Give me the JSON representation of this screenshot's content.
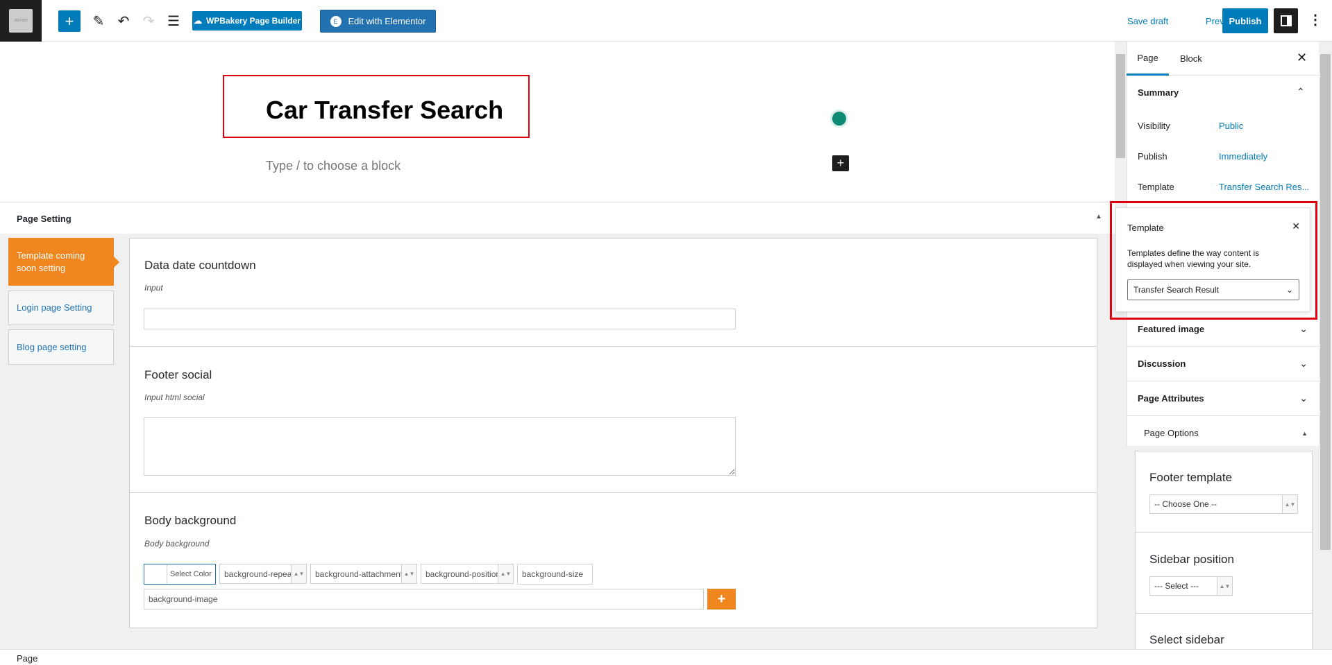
{
  "topbar": {
    "logo_text": "300×300",
    "wpbakery_label": "WPBakery Page Builder",
    "elementor_label": "Edit with Elementor",
    "save_draft": "Save draft",
    "preview": "Preview",
    "publish": "Publish"
  },
  "editor": {
    "title": "Car Transfer Search",
    "block_placeholder": "Type / to choose a block"
  },
  "page_setting": {
    "header": "Page Setting",
    "tabs": [
      {
        "label": "Template coming soon setting",
        "active": true
      },
      {
        "label": "Login page Setting"
      },
      {
        "label": "Blog page setting"
      }
    ],
    "sections": [
      {
        "title": "Data date countdown",
        "label": "Input",
        "value": ""
      },
      {
        "title": "Footer social",
        "label": "Input html social",
        "value": ""
      },
      {
        "title": "Body background",
        "label": "Body background",
        "controls": {
          "color": "Select Color",
          "repeat": "background-repeat",
          "attachment": "background-attachment",
          "position": "background-position",
          "size": "background-size",
          "image": "background-image"
        }
      }
    ]
  },
  "sidebar": {
    "tabs": [
      "Page",
      "Block"
    ],
    "active_tab": "Page",
    "summary": {
      "title": "Summary",
      "rows": [
        {
          "label": "Visibility",
          "value": "Public"
        },
        {
          "label": "Publish",
          "value": "Immediately"
        },
        {
          "label": "Template",
          "value": "Transfer Search Res..."
        }
      ]
    },
    "popover": {
      "title": "Template",
      "description_line1": "Templates define the way content is",
      "description_line2": "displayed when viewing your site.",
      "selected": "Transfer Search Result"
    },
    "sections": [
      "Featured image",
      "Discussion",
      "Page Attributes"
    ],
    "page_options": {
      "title": "Page Options",
      "footer_template": {
        "label": "Footer template",
        "selected": "-- Choose One --"
      },
      "sidebar_position": {
        "label": "Sidebar position",
        "selected": "--- Select ---"
      },
      "select_sidebar": {
        "label": "Select sidebar"
      }
    }
  },
  "statusbar": {
    "breadcrumb": "Page"
  },
  "colors": {
    "accent": "#007cba",
    "orange": "#f0861f",
    "highlight": "#e0000f",
    "elementor": "#2271b1"
  }
}
